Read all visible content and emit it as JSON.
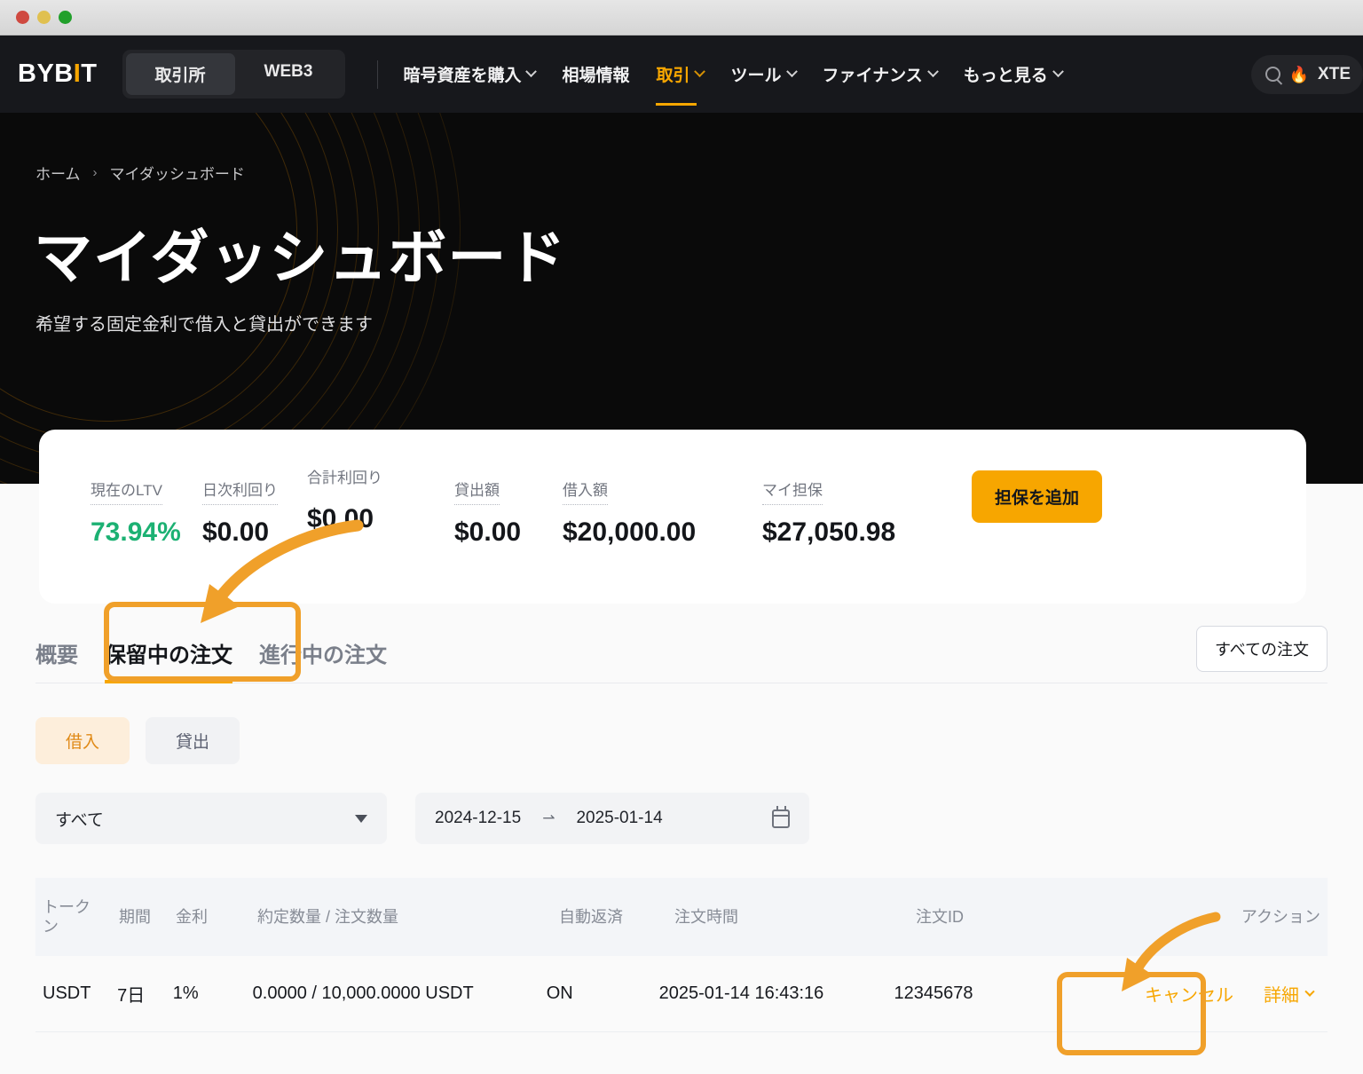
{
  "window": {
    "dots": [
      "red",
      "yellow",
      "green"
    ]
  },
  "nav": {
    "logo": "BYB",
    "logo_accent": "I",
    "logo_tail": "T",
    "segments": [
      {
        "label": "取引所",
        "active": true
      },
      {
        "label": "WEB3",
        "active": false
      }
    ],
    "links": [
      {
        "label": "暗号資産を購入",
        "caret": true,
        "active": false
      },
      {
        "label": "相場情報",
        "caret": false,
        "active": false
      },
      {
        "label": "取引",
        "caret": true,
        "active": true
      },
      {
        "label": "ツール",
        "caret": true,
        "active": false
      },
      {
        "label": "ファイナンス",
        "caret": true,
        "active": false
      },
      {
        "label": "もっと見る",
        "caret": true,
        "active": false
      }
    ],
    "search_icon": "search-icon",
    "hot_icon": "🔥",
    "hot_text": "XTE",
    "accent_color": "#f7a600"
  },
  "hero": {
    "breadcrumb": {
      "home": "ホーム",
      "separator": "›",
      "current": "マイダッシュボード"
    },
    "title": "マイダッシュボード",
    "subtitle": "希望する固定金利で借入と貸出ができます"
  },
  "stats": {
    "items": [
      {
        "label": "現在のLTV",
        "value": "73.94%",
        "color": "#1cb173",
        "offset": 0
      },
      {
        "label": "日次利回り",
        "value": "$0.00",
        "color": "#14161a",
        "offset": 0
      },
      {
        "label": "合計利回り",
        "value": "$0.00",
        "color": "#14161a",
        "offset": -14
      },
      {
        "label": "貸出額",
        "value": "$0.00",
        "color": "#14161a",
        "offset": 0
      },
      {
        "label": "借入額",
        "value": "$20,000.00",
        "color": "#14161a",
        "offset": 0
      },
      {
        "label": "マイ担保",
        "value": "$27,050.98",
        "color": "#14161a",
        "offset": 0
      }
    ],
    "collateral_button": "担保を追加"
  },
  "tabs": {
    "items": [
      {
        "label": "概要",
        "active": false
      },
      {
        "label": "保留中の注文",
        "active": true
      },
      {
        "label": "進行中の注文",
        "active": false
      }
    ],
    "all_orders_button": "すべての注文"
  },
  "pills": [
    {
      "label": "借入",
      "active": true
    },
    {
      "label": "貸出",
      "active": false
    }
  ],
  "filters": {
    "select_value": "すべて",
    "date_start": "2024-12-15",
    "date_arrow": "⇀",
    "date_end": "2025-01-14",
    "calendar_icon": "calendar-icon"
  },
  "table": {
    "columns": [
      "トークン",
      "期間",
      "金利",
      "約定数量 / 注文数量",
      "自動返済",
      "注文時間",
      "注文ID",
      "アクション"
    ],
    "rows": [
      {
        "token": "USDT",
        "term": "7日",
        "rate": "1%",
        "amount": "0.0000 / 10,000.0000 USDT",
        "auto_repay": "ON",
        "order_time": "2025-01-14 16:43:16",
        "order_id": "12345678",
        "action_cancel": "キャンセル",
        "action_detail": "詳細"
      }
    ]
  },
  "annotations": {
    "highlight_color": "#f0a02a",
    "boxes": [
      "pending-orders-tab",
      "cancel-link"
    ],
    "arrows": [
      "arrow-to-pending-tab",
      "arrow-to-cancel"
    ]
  }
}
